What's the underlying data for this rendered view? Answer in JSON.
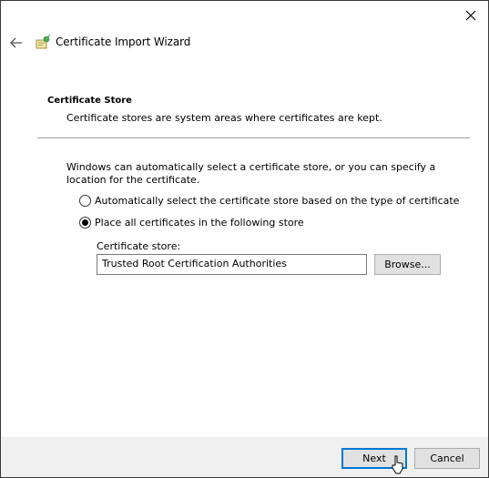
{
  "window": {
    "title": "Certificate Import Wizard",
    "close_icon": "close-icon",
    "back_icon": "back-arrow-icon",
    "app_icon": "certificate-wizard-icon"
  },
  "section": {
    "title": "Certificate Store",
    "description": "Certificate stores are system areas where certificates are kept."
  },
  "content": {
    "intro": "Windows can automatically select a certificate store, or you can specify a location for the certificate.",
    "options": [
      {
        "label": "Automatically select the certificate store based on the type of certificate",
        "selected": false
      },
      {
        "label": "Place all certificates in the following store",
        "selected": true
      }
    ],
    "store_label": "Certificate store:",
    "store_value": "Trusted Root Certification Authorities",
    "browse_label": "Browse..."
  },
  "footer": {
    "next_label": "Next",
    "cancel_label": "Cancel"
  },
  "colors": {
    "accent": "#0078d7",
    "footer_bg": "#f0f0f0",
    "button_bg": "#e1e1e1"
  }
}
